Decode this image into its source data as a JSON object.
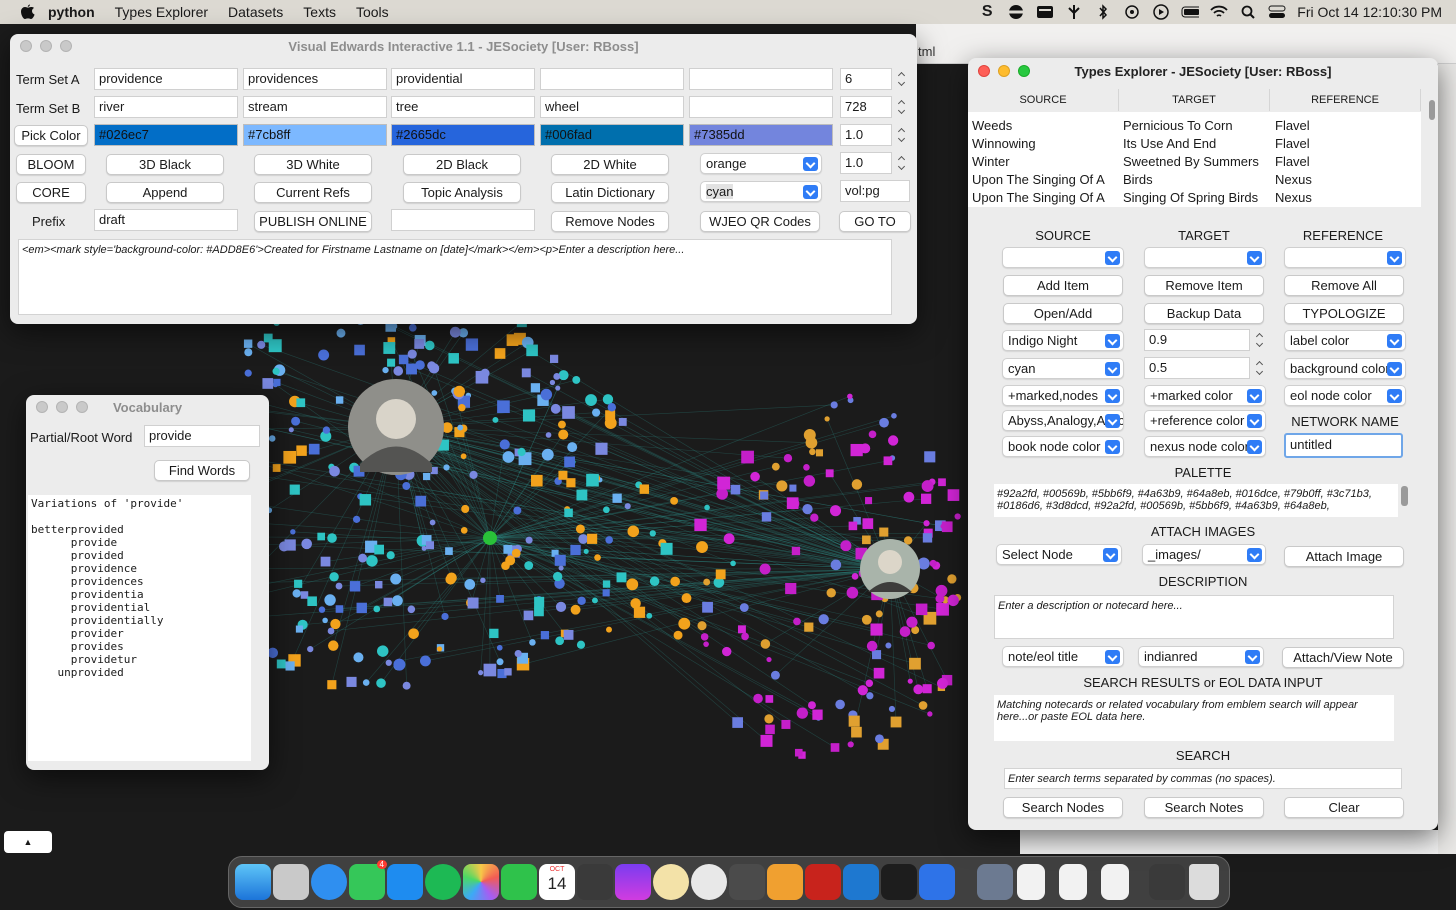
{
  "menubar": {
    "app_name": "python",
    "items": [
      "Types Explorer",
      "Datasets",
      "Texts",
      "Tools"
    ],
    "clock": "Fri Oct 14  12:10:30 PM"
  },
  "browser": {
    "url_fragment": "tml"
  },
  "vei": {
    "title": "Visual Edwards Interactive 1.1 - JESociety [User: RBoss]",
    "term_set_a": {
      "label": "Term Set A",
      "terms": [
        "providence",
        "providences",
        "providential",
        "",
        ""
      ],
      "value": "6"
    },
    "term_set_b": {
      "label": "Term Set B",
      "terms": [
        "river",
        "stream",
        "tree",
        "wheel",
        ""
      ],
      "value": "728"
    },
    "pick_color": {
      "label": "Pick Color",
      "colors": [
        {
          "text": "#026ec7",
          "hex": "#026ec7"
        },
        {
          "text": "#7cb8ff",
          "hex": "#7cb8ff"
        },
        {
          "text": "#2665dc",
          "hex": "#2665dc"
        },
        {
          "text": "#006fad",
          "hex": "#006fad"
        },
        {
          "text": "#7385dd",
          "hex": "#7385dd"
        }
      ],
      "value": "1.0"
    },
    "row4": {
      "buttons": [
        "BLOOM",
        "3D Black",
        "3D White",
        "2D Black",
        "2D White"
      ],
      "select": "orange",
      "value": "1.0"
    },
    "row5": {
      "buttons": [
        "CORE",
        "Append",
        "Current Refs",
        "Topic Analysis",
        "Latin Dictionary"
      ],
      "select": "cyan",
      "field": "vol:pg"
    },
    "row6": {
      "label": "Prefix",
      "prefix_value": "draft",
      "publish": "PUBLISH ONLINE",
      "empty_field": "",
      "remove_nodes": "Remove Nodes",
      "qr": "WJEO QR Codes",
      "goto": "GO TO"
    },
    "description": "<em><mark style='background-color: #ADD8E6'>Created for Firstname Lastname on [date]</mark></em><p>Enter a description here..."
  },
  "vocab": {
    "title": "Vocabulary",
    "label": "Partial/Root Word",
    "value": "provide",
    "find_button": "Find Words",
    "results": "Variations of 'provide'\n\nbetterprovided\n      provide\n      provided\n      providence\n      providences\n      providentia\n      providential\n      providentially\n      provider\n      provides\n      providetur\n    unprovided"
  },
  "types": {
    "title": "Types Explorer - JESociety [User: RBoss]",
    "columns": [
      "SOURCE",
      "TARGET",
      "REFERENCE"
    ],
    "rows": [
      [
        "Weeds",
        "Pernicious To Corn",
        "Flavel"
      ],
      [
        "Winnowing",
        "Its Use And End",
        "Flavel"
      ],
      [
        "Winter",
        "Sweetned By Summers",
        "Flavel"
      ],
      [
        "Upon The Singing Of A",
        "Birds",
        "Nexus"
      ],
      [
        "Upon The Singing Of A",
        "Singing Of Spring Birds",
        "Nexus"
      ]
    ],
    "section_headers": [
      "SOURCE",
      "TARGET",
      "REFERENCE"
    ],
    "buttons_r1": [
      "Add Item",
      "Remove Item",
      "Remove All"
    ],
    "buttons_r2": [
      "Open/Add",
      "Backup Data",
      "TYPOLOGIZE"
    ],
    "row_a": {
      "select1": "Indigo Night",
      "num": "0.9",
      "select3": "label color"
    },
    "row_b": {
      "select1": "cyan",
      "num": "0.5",
      "select3": "background color"
    },
    "row_c": {
      "select1": "+marked,nodes",
      "select2": "+marked color",
      "select3": "eol node color"
    },
    "row_d": {
      "select1": "Abyss,Analogy,Affliction",
      "select2": "+reference color",
      "label3": "NETWORK NAME"
    },
    "row_e": {
      "select1": "book node color",
      "select2": "nexus node color",
      "network_name": "untitled"
    },
    "palette_header": "PALETTE",
    "palette": "#92a2fd, #00569b, #5bb6f9, #4a63b9, #64a8eb, #016dce, #79b0ff, #3c71b3, #0186d6, #3d8dcd, #92a2fd, #00569b, #5bb6f9, #4a63b9, #64a8eb,",
    "attach_header": "ATTACH IMAGES",
    "attach": {
      "select1": "Select Node",
      "select2": "_images/",
      "button": "Attach Image"
    },
    "description_header": "DESCRIPTION",
    "description_placeholder": "Enter a description or notecard here...",
    "note": {
      "select1": "note/eol title",
      "select2": "indianred",
      "button": "Attach/View Note"
    },
    "search_results_header": "SEARCH RESULTS or EOL DATA INPUT",
    "search_results_text": "Matching notecards or related vocabulary from emblem search will appear here...or paste EOL data here.",
    "search_header": "SEARCH",
    "search_placeholder": "Enter search terms separated by commas (no spaces).",
    "search_buttons": [
      "Search Nodes",
      "Search Notes",
      "Clear"
    ]
  },
  "dock": {
    "calendar_month": "OCT",
    "calendar_day": "14",
    "messages_badge": "4"
  }
}
